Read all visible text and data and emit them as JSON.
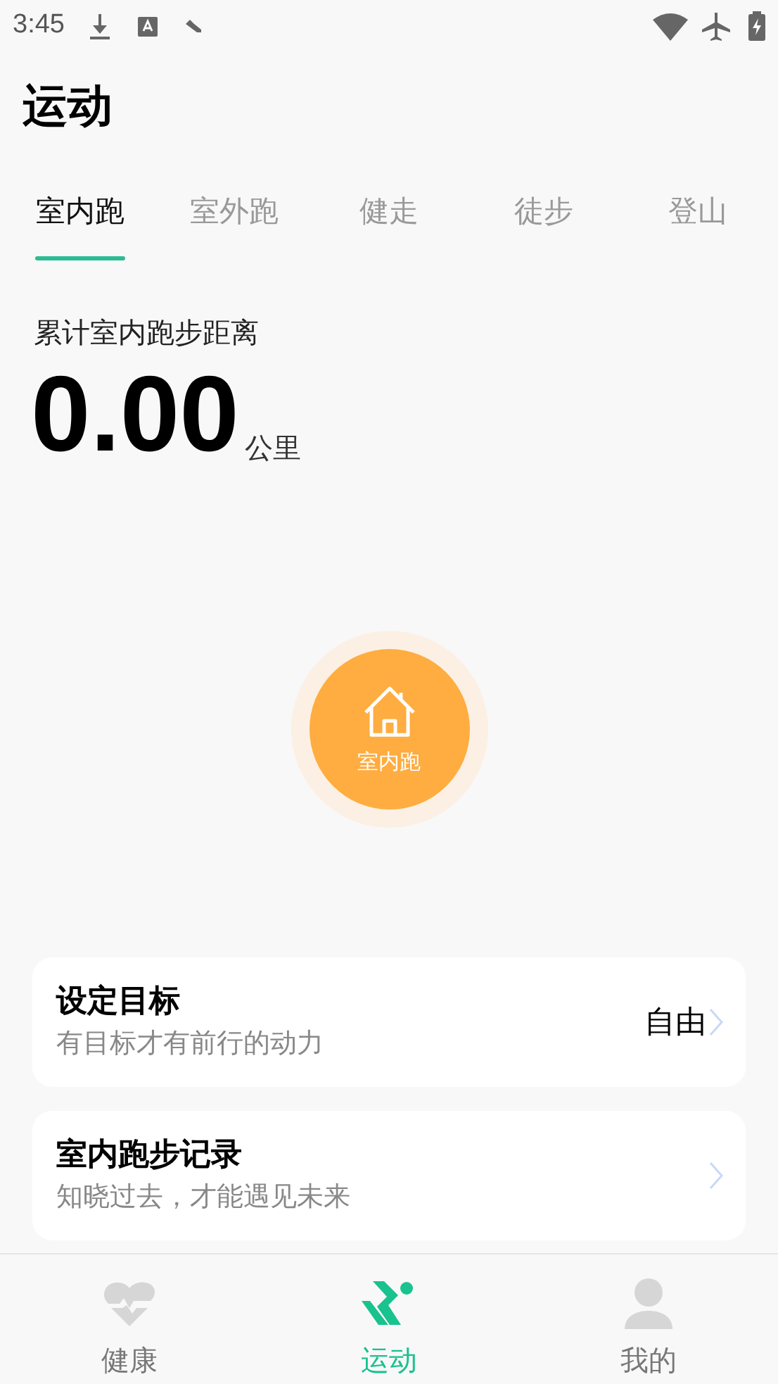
{
  "status_bar": {
    "time": "3:45"
  },
  "title": "运动",
  "tabs": [
    {
      "label": "室内跑",
      "selected": true
    },
    {
      "label": "室外跑",
      "selected": false
    },
    {
      "label": "健走",
      "selected": false
    },
    {
      "label": "徒步",
      "selected": false
    },
    {
      "label": "登山",
      "selected": false
    }
  ],
  "summary": {
    "label": "累计室内跑步距离",
    "value": "0.00",
    "unit": "公里"
  },
  "start_button": {
    "label": "室内跑"
  },
  "cards": [
    {
      "title": "设定目标",
      "subtitle": "有目标才有前行的动力",
      "value": "自由"
    },
    {
      "title": "室内跑步记录",
      "subtitle": "知晓过去，才能遇见未来"
    }
  ],
  "bottom_nav": [
    {
      "label": "健康",
      "kind": "heart",
      "selected": false
    },
    {
      "label": "运动",
      "kind": "run",
      "selected": true
    },
    {
      "label": "我的",
      "kind": "person",
      "selected": false
    }
  ]
}
